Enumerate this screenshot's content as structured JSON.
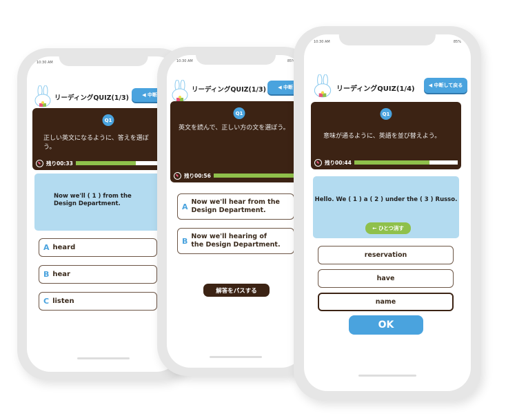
{
  "status": {
    "time": "10:30 AM",
    "battery": "85%"
  },
  "colors": {
    "accent": "#4aa3de",
    "panel": "#3c2314",
    "progress": "#8fc04b",
    "sentence_bg": "#b3dbf0"
  },
  "phones": [
    {
      "title": "リーディングQUIZ(1/3)",
      "back": "◀ 中断して戻る",
      "badge": "Q1",
      "instruction": "正しい英文になるように、答えを選ぼう。",
      "timer": "残り00:33",
      "progress": 0.57,
      "sentence": "Now we'll ( 1 ) from the Design Department.",
      "options": [
        {
          "letter": "A",
          "text": "heard"
        },
        {
          "letter": "B",
          "text": "hear"
        },
        {
          "letter": "C",
          "text": "listen"
        }
      ]
    },
    {
      "title": "リーディングQUIZ(1/3)",
      "back": "◀ 中断して戻る",
      "badge": "Q1",
      "instruction": "英文を読んで、正しい方の文を選ぼう。",
      "timer": "残り00:56",
      "progress": 0.93,
      "options": [
        {
          "letter": "A",
          "text": "Now we'll hear from the Design Department."
        },
        {
          "letter": "B",
          "text": "Now we'll hearing of the Design Department."
        }
      ],
      "pass": "解答をパスする"
    },
    {
      "title": "リーディングQUIZ(1/4)",
      "back": "◀ 中断して戻る",
      "badge": "Q1",
      "instruction": "意味が通るように、英語を並び替えよう。",
      "timer": "残り00:44",
      "progress": 0.73,
      "sentence": "Hello. We ( 1 ) a ( 2 ) under the ( 3 ) Russo.",
      "undo": "← ひとつ消す",
      "words": [
        "reservation",
        "have",
        "name"
      ],
      "ok": "OK"
    }
  ]
}
